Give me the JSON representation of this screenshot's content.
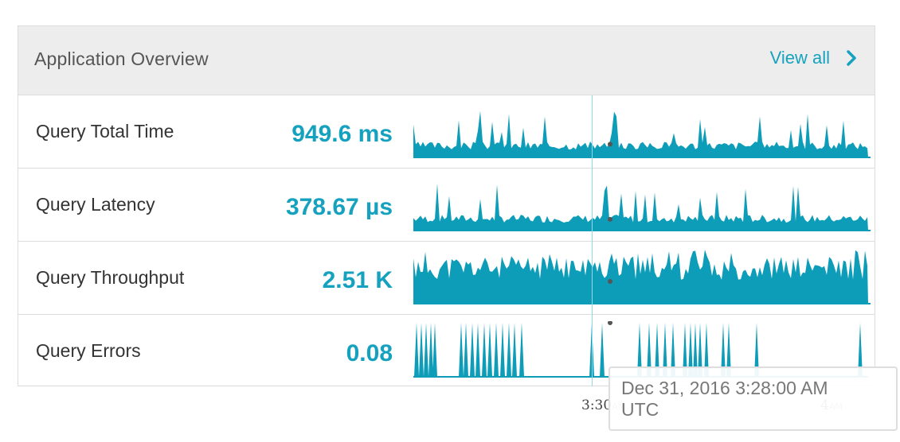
{
  "header": {
    "title": "Application Overview",
    "view_all_label": "View all",
    "view_all_icon": "chevron-right-icon"
  },
  "colors": {
    "accent": "#16a2bf",
    "spark_fill": "#0e9db8",
    "header_bg": "#ededed"
  },
  "metrics": [
    {
      "name": "Query Total Time",
      "value": "949.6 ms"
    },
    {
      "name": "Query Latency",
      "value": "378.67 µs"
    },
    {
      "name": "Query Throughput",
      "value": "2.51 K"
    },
    {
      "name": "Query Errors",
      "value": "0.08"
    }
  ],
  "axis": {
    "ticks": [
      {
        "time": "3:30",
        "ampm": "AM"
      },
      {
        "time": "4",
        "ampm": "AM"
      }
    ]
  },
  "tooltip": {
    "line1": "Dec 31, 2016 3:28:00 AM",
    "line2": "UTC"
  }
}
